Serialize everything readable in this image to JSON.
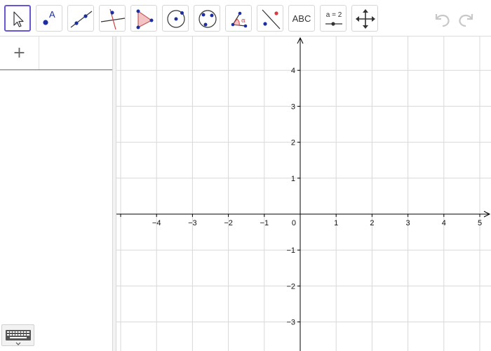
{
  "toolbar": {
    "tools": [
      {
        "name": "move-tool",
        "label": ""
      },
      {
        "name": "point-tool",
        "label": "A"
      },
      {
        "name": "line-tool",
        "label": ""
      },
      {
        "name": "perpendicular-line-tool",
        "label": ""
      },
      {
        "name": "polygon-tool",
        "label": ""
      },
      {
        "name": "circle-center-point-tool",
        "label": ""
      },
      {
        "name": "circle-three-points-tool",
        "label": ""
      },
      {
        "name": "angle-tool",
        "label": "α"
      },
      {
        "name": "reflect-tool",
        "label": ""
      },
      {
        "name": "text-tool",
        "label": "ABC"
      },
      {
        "name": "slider-tool",
        "label": "a = 2"
      },
      {
        "name": "move-graphics-view-tool",
        "label": ""
      }
    ],
    "selected_tool": "move-tool",
    "icons": {
      "undo": "undo-icon",
      "redo": "redo-icon"
    }
  },
  "algebra": {
    "add_label": "+",
    "keyboard_icon": "keyboard-icon"
  },
  "graphics": {
    "x_ticks": [
      "−4",
      "−3",
      "−2",
      "−1",
      "0",
      "1",
      "2",
      "3",
      "4",
      "5"
    ],
    "y_ticks": [
      "4",
      "3",
      "2",
      "1",
      "−1",
      "−2",
      "−3"
    ],
    "x_range": [
      -5,
      5.3
    ],
    "y_range": [
      -3.8,
      5
    ],
    "grid": true
  },
  "colors": {
    "accent": "#6557d2",
    "point": "#1c2fa0",
    "polygon_fill": "#f4c4c4",
    "polygon_stroke": "#c15c5c",
    "red": "#d33c3c",
    "grid": "#d8d8d8",
    "axis": "#000000"
  }
}
